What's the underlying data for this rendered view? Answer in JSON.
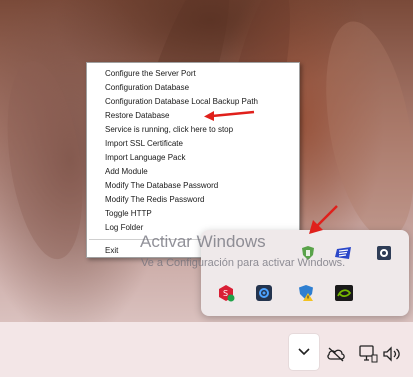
{
  "context_menu": {
    "items": [
      "Configure the Server Port",
      "Configuration Database",
      "Configuration Database Local Backup Path",
      "Restore Database",
      "Service is running, click here to stop",
      "Import SSL Certificate",
      "Import Language Pack",
      "Add Module",
      "Modify The Database Password",
      "Modify The Redis Password",
      "Toggle HTTP",
      "Log Folder"
    ],
    "exit_label": "Exit"
  },
  "watermark": {
    "title": "Activar Windows",
    "subtitle": "Ve a Configuración para activar Windows."
  },
  "tray_flyout": {
    "icons": [
      "app-shield-icon",
      "protonvpn-icon",
      "speaker-app-icon",
      "red-hex-app-icon",
      "gear-app-icon",
      "windows-security-icon",
      "nvidia-icon"
    ]
  },
  "taskbar": {
    "icons": [
      "chevron-up-icon",
      "cloud-off-icon",
      "monitor-network-icon",
      "volume-icon"
    ]
  },
  "annotations": {
    "arrow_color": "#e0201b"
  }
}
